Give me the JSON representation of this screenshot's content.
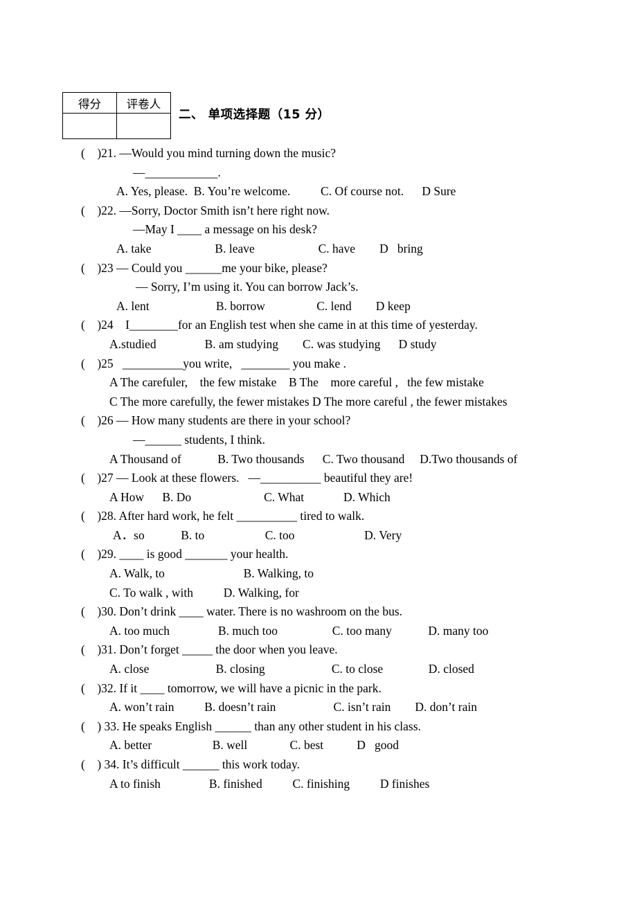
{
  "score_table": {
    "headers": [
      "得分",
      "评卷人"
    ],
    "values": [
      "",
      ""
    ]
  },
  "section": {
    "title": "二、 单项选择题（15 分）"
  },
  "questions": [
    {
      "marker": "(    )21.",
      "stem": "(    )21. —Would you mind turning down the music?",
      "cont": "—____________.",
      "options": "A. Yes, please.  B. You’re welcome.          C. Of course not.      D Sure"
    },
    {
      "marker": "(    )22.",
      "stem": "(    )22. —Sorry, Doctor Smith isn’t here right now.",
      "cont": "—May I ____ a message on his desk?",
      "options": "A. take                     B. leave                     C. have        D   bring"
    },
    {
      "marker": "(    )23",
      "stem": "(    )23 — Could you ______me your bike, please?",
      "cont": "— Sorry, I’m using it. You can borrow Jack’s.",
      "options": "A. lent                      B. borrow                 C. lend        D keep"
    },
    {
      "marker": "(    )24",
      "stem": "(    )24    I________for an English test when she came in at this time of yesterday.",
      "options": "A.studied                B. am studying        C. was studying      D study"
    },
    {
      "marker": "(    )25",
      "stem": "(    )25   __________you write,   ________ you make .",
      "options_a": "A The carefuler,    the few mistake    B The    more careful ,   the few mistake",
      "options_b": "C The more carefully, the fewer mistakes D The more careful , the fewer mistakes"
    },
    {
      "marker": "(    )26",
      "stem": "(    )26 — How many students are there in your school?",
      "cont": "—______ students, I think.",
      "options": "A Thousand of            B. Two thousands      C. Two thousand     D.Two thousands of"
    },
    {
      "marker": "(    )27",
      "stem": "(    )27 — Look at these flowers.   —__________ beautiful they are!",
      "options": "A How      B. Do                        C. What             D. Which"
    },
    {
      "marker": "(    )28.",
      "stem": "(    )28. After hard work, he felt __________ tired to walk.",
      "options": "A．so            B. to                    C. too                       D. Very"
    },
    {
      "marker": "(    )29.",
      "stem": "(    )29. ____ is good _______ your health.",
      "options_a": "A. Walk, to                          B. Walking, to",
      "options_b": "C. To walk , with          D. Walking, for"
    },
    {
      "marker": "(    )30.",
      "stem": "(    )30. Don’t drink ____ water. There is no washroom on the bus.",
      "options": "A. too much                B. much too                  C. too many            D. many too"
    },
    {
      "marker": "(    )31.",
      "stem": "(    )31. Don’t forget _____ the door when you leave.",
      "options": "A. close                      B. closing                      C. to close               D. closed"
    },
    {
      "marker": "(    )32.",
      "stem": "(    )32. If it ____ tomorrow, we will have a picnic in the park.",
      "options": "A. won’t rain          B. doesn’t rain                   C. isn’t rain        D. don’t rain"
    },
    {
      "marker": "(    ) 33.",
      "stem": "(    ) 33. He speaks English ______ than any other student in his class.",
      "options": "A. better                    B. well              C. best           D   good"
    },
    {
      "marker": "(    ) 34.",
      "stem": "(    ) 34. It’s difficult ______ this work today.",
      "options": "A to finish                B. finished          C. finishing          D finishes"
    }
  ]
}
